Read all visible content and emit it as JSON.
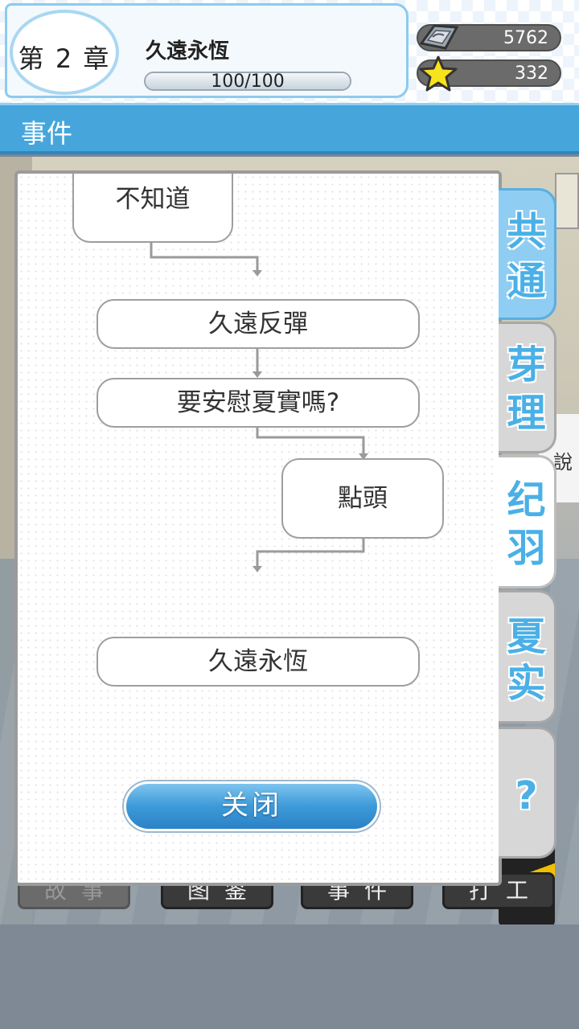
{
  "header": {
    "chapter": "第 2 章",
    "chapter_name": "久遠永恆",
    "progress_text": "100/100",
    "progress_fraction": 1.0,
    "gems": "5762",
    "stars": "332",
    "gem_icon": "gem-stone-icon",
    "star_icon": "star-icon"
  },
  "title_bar": {
    "label": "事件"
  },
  "background": {
    "speech_text": "說",
    "nav": [
      "故事",
      "图鉴",
      "事件",
      "打工"
    ]
  },
  "popup": {
    "nodes": [
      "不知道",
      "久遠反彈",
      "要安慰夏實嗎?",
      "點頭",
      "久遠永恆"
    ],
    "close_label": "关闭"
  },
  "tabs": [
    {
      "label_top": "共",
      "label_bottom": "通",
      "state": "active"
    },
    {
      "label_top": "芽",
      "label_bottom": "理",
      "state": "normal"
    },
    {
      "label_top": "纪",
      "label_bottom": "羽",
      "state": "selected"
    },
    {
      "label_top": "夏",
      "label_bottom": "实",
      "state": "normal"
    },
    {
      "label_top": "?",
      "label_bottom": "",
      "state": "normal"
    }
  ],
  "colors": {
    "accent": "#46a6dc",
    "tab_text": "#4ab0e6",
    "button": "#3d9ad8"
  }
}
